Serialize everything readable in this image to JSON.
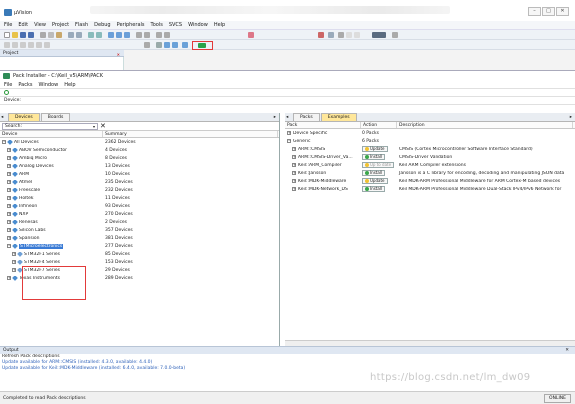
{
  "window": {
    "title": "µVision",
    "controls": [
      "–",
      "□",
      "✕"
    ]
  },
  "menubar": [
    "File",
    "Edit",
    "View",
    "Project",
    "Flash",
    "Debug",
    "Peripherals",
    "Tools",
    "SVCS",
    "Window",
    "Help"
  ],
  "toolbar": {
    "target": "stm32f429_LED_ENABLE"
  },
  "project_panel": {
    "title": "Project"
  },
  "pack_installer": {
    "title": "Pack Installer - C:\\Keil_v5\\ARM\\PACK",
    "menu": [
      "File",
      "Packs",
      "Window",
      "Help"
    ],
    "device_label": "Device:",
    "left_tabs": [
      "Devices",
      "Boards"
    ],
    "search_placeholder": "Search:",
    "columns": [
      "Device",
      "Summary"
    ],
    "rows": [
      {
        "name": "All Devices",
        "summary": "2362 Devices",
        "level": 0,
        "expander": "−"
      },
      {
        "name": "ABOV Semiconductor",
        "summary": "4 Devices",
        "level": 1,
        "expander": "+"
      },
      {
        "name": "Ambiq Micro",
        "summary": "8 Devices",
        "level": 1,
        "expander": "+"
      },
      {
        "name": "Analog Devices",
        "summary": "13 Devices",
        "level": 1,
        "expander": "+"
      },
      {
        "name": "ARM",
        "summary": "10 Devices",
        "level": 1,
        "expander": "+"
      },
      {
        "name": "Atmel",
        "summary": "235 Devices",
        "level": 1,
        "expander": "+"
      },
      {
        "name": "Freescale",
        "summary": "232 Devices",
        "level": 1,
        "expander": "+"
      },
      {
        "name": "Holtek",
        "summary": "11 Devices",
        "level": 1,
        "expander": "+"
      },
      {
        "name": "Infineon",
        "summary": "93 Devices",
        "level": 1,
        "expander": "+"
      },
      {
        "name": "NXP",
        "summary": "270 Devices",
        "level": 1,
        "expander": "+"
      },
      {
        "name": "Renesas",
        "summary": "2 Devices",
        "level": 1,
        "expander": "+"
      },
      {
        "name": "Silicon Labs",
        "summary": "357 Devices",
        "level": 1,
        "expander": "+"
      },
      {
        "name": "Spansion",
        "summary": "381 Devices",
        "level": 1,
        "expander": "+"
      },
      {
        "name": "STMicroelectronics",
        "summary": "277 Devices",
        "level": 1,
        "expander": "−",
        "selected": true
      },
      {
        "name": "STM32F1 Series",
        "summary": "85 Devices",
        "level": 2,
        "expander": "+"
      },
      {
        "name": "STM32F4 Series",
        "summary": "153 Devices",
        "level": 2,
        "expander": "+"
      },
      {
        "name": "STM32F7 Series",
        "summary": "29 Devices",
        "level": 2,
        "expander": "+"
      },
      {
        "name": "Texas Instruments",
        "summary": "289 Devices",
        "level": 1,
        "expander": "+"
      }
    ],
    "right_tabs": [
      "Packs",
      "Examples"
    ],
    "pack_columns": [
      "Pack",
      "Action",
      "Description"
    ],
    "packs": [
      {
        "name": "Device Specific",
        "action": "0 Packs",
        "description": "",
        "expander": "+",
        "level": 0
      },
      {
        "name": "Generic",
        "action": "6 Packs",
        "description": "",
        "expander": "−",
        "level": 0
      },
      {
        "name": "ARM::CMSIS",
        "action": "Update",
        "description": "CMSIS (Cortex Microcontroller Software Interface Standard)",
        "expander": "+",
        "level": 1,
        "btn": "yellow"
      },
      {
        "name": "ARM::CMSIS-Driver_Va...",
        "action": "Install",
        "description": "CMSIS-Driver Validation",
        "expander": "+",
        "level": 1,
        "btn": "green"
      },
      {
        "name": "Keil::ARM_Compiler",
        "action": "Up to date",
        "description": "Keil ARM Compiler extensions",
        "expander": "+",
        "level": 1,
        "btn": "muted"
      },
      {
        "name": "Keil::Jansson",
        "action": "Install",
        "description": "Jansson is a C library for encoding, decoding and manipulating JSON data",
        "expander": "+",
        "level": 1,
        "btn": "green"
      },
      {
        "name": "Keil::MDK-Middleware",
        "action": "Update",
        "description": "Keil MDK-ARM Professional Middleware for ARM Cortex-M based devices",
        "expander": "+",
        "level": 1,
        "btn": "yellow"
      },
      {
        "name": "Keil::MDK-Network_DS",
        "action": "Install",
        "description": "Keil MDK-ARM Professional Middleware Dual-Stack IPv4/IPv6 Network for",
        "expander": "+",
        "level": 1,
        "btn": "green"
      }
    ]
  },
  "output": {
    "title": "Output",
    "lines": [
      "Refresh Pack descriptions",
      "Update available for ARM::CMSIS (installed: 4.3.0,  available: 4.4.0)",
      "Update available for Keil::MDK-Middleware (installed: 6.4.0,  available: 7.0.0-beta)"
    ]
  },
  "watermark": "https://blog.csdn.net/lm_dw09",
  "status": {
    "left": "Completed to read Pack descriptions",
    "right": "ONLINE"
  }
}
